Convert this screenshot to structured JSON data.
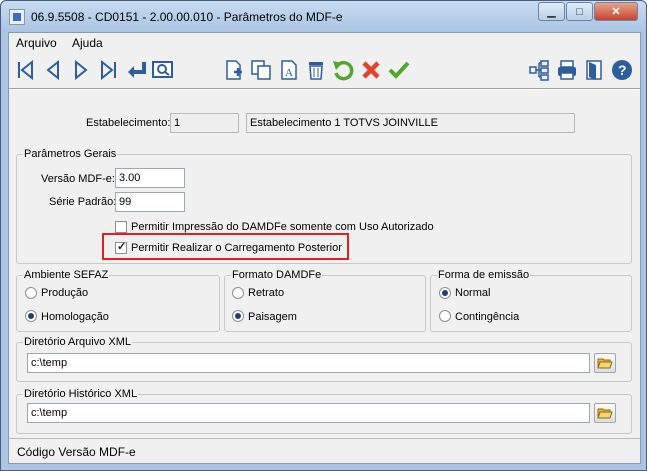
{
  "window": {
    "title": "06.9.5508 - CD0151 - 2.00.00.010 - Parâmetros do MDF-e"
  },
  "menu": {
    "arquivo": "Arquivo",
    "ajuda": "Ajuda"
  },
  "toolbar": {
    "icons": [
      "first-record-icon",
      "previous-record-icon",
      "next-record-icon",
      "last-record-icon",
      "goto-icon",
      "search-record-icon",
      "new-record-icon",
      "copy-record-icon",
      "edit-record-icon",
      "delete-record-icon",
      "undo-icon",
      "cancel-icon",
      "save-icon",
      "zoom-list-icon",
      "print-icon",
      "exit-icon",
      "help-icon"
    ]
  },
  "estabelecimento": {
    "label": "Estabelecimento:",
    "code": "1",
    "name": "Estabelecimento 1 TOTVS JOINVILLE"
  },
  "parametros": {
    "title": "Parâmetros Gerais",
    "versao_label": "Versão MDF-e:",
    "versao_value": "3.00",
    "serie_label": "Série Padrão:",
    "serie_value": "99",
    "chk_impressao": "Permitir Impressão do DAMDFe somente com Uso Autorizado",
    "chk_impressao_checked": false,
    "chk_carregamento": "Permitir Realizar o Carregamento Posterior",
    "chk_carregamento_checked": true
  },
  "ambiente": {
    "title": "Ambiente SEFAZ",
    "opt1": "Produção",
    "opt2": "Homologação",
    "selected": "Homologação"
  },
  "formato": {
    "title": "Formato DAMDFe",
    "opt1": "Retrato",
    "opt2": "Paisagem",
    "selected": "Paisagem"
  },
  "emissao": {
    "title": "Forma de emissão",
    "opt1": "Normal",
    "opt2": "Contingência",
    "selected": "Normal"
  },
  "dir_xml": {
    "title": "Diretório Arquivo XML",
    "value": "c:\\temp"
  },
  "dir_hist": {
    "title": "Diretório Histórico XML",
    "value": "c:\\temp"
  },
  "status": {
    "text": "Código Versão MDF-e"
  },
  "colors": {
    "highlight": "#e02020",
    "titlebar": "#aac4e2",
    "accent": "#2c5e9e"
  }
}
